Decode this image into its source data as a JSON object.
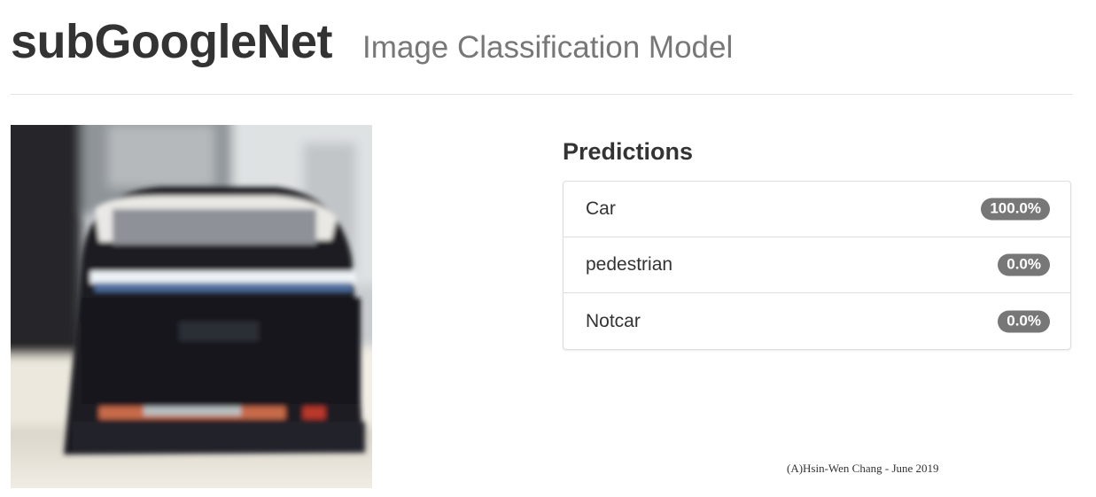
{
  "header": {
    "title": "subGoogleNet",
    "subtitle": "Image Classification Model"
  },
  "input_image": {
    "description": "car-photo",
    "colors": {
      "sky": "#cfd3d6",
      "car_body": "#1c1d23",
      "road": "#f2efe8"
    }
  },
  "predictions": {
    "title": "Predictions",
    "items": [
      {
        "label": "Car",
        "score": "100.0%"
      },
      {
        "label": "pedestrian",
        "score": "0.0%"
      },
      {
        "label": "Notcar",
        "score": "0.0%"
      }
    ]
  },
  "footer": {
    "credit": "(A)Hsin-Wen Chang - June 2019"
  },
  "colors": {
    "badge_bg": "#777777",
    "title_text": "#333333",
    "subtitle_text": "#777777",
    "border": "#dddddd"
  }
}
